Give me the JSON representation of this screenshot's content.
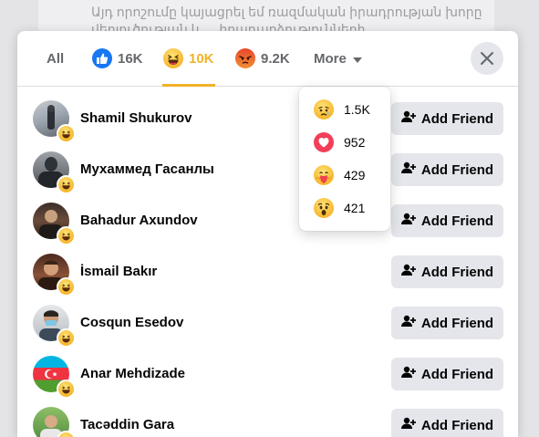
{
  "background": {
    "text_line_1": "Այդ որոշումը կայացրել եմ ռազմական իրադրության խորը",
    "text_line_2": "վերլուծության և ... իրադարձությունների"
  },
  "tabs": {
    "all_label": "All",
    "like_count": "16K",
    "haha_count": "10K",
    "angry_count": "9.2K",
    "more_label": "More",
    "active": "haha"
  },
  "more_dropdown": {
    "items": [
      {
        "reaction": "sad",
        "count": "1.5K"
      },
      {
        "reaction": "love",
        "count": "952"
      },
      {
        "reaction": "care",
        "count": "429"
      },
      {
        "reaction": "wow",
        "count": "421"
      }
    ]
  },
  "people": [
    {
      "name": "Shamil Shukurov",
      "button": "Add Friend",
      "reaction": "haha"
    },
    {
      "name": "Мухаммед Гасанлы",
      "button": "Add Friend",
      "reaction": "haha"
    },
    {
      "name": "Bahadur Axundov",
      "button": "Add Friend",
      "reaction": "haha"
    },
    {
      "name": "İsmail Bakır",
      "button": "Add Friend",
      "reaction": "haha"
    },
    {
      "name": "Cosqun Esedov",
      "button": "Add Friend",
      "reaction": "haha"
    },
    {
      "name": "Anar Mehdizade",
      "button": "Add Friend",
      "reaction": "haha"
    },
    {
      "name": "Tacəddin Gara",
      "button": "Add Friend",
      "reaction": "haha"
    }
  ],
  "icons": {
    "close": "close-icon",
    "more_caret": "caret-down-icon",
    "add_friend": "add-person-icon"
  },
  "colors": {
    "active_tab": "#f0b229",
    "like_blue": "#1877f2",
    "button_gray": "#e4e6eb",
    "secondary_text": "#65676b"
  }
}
